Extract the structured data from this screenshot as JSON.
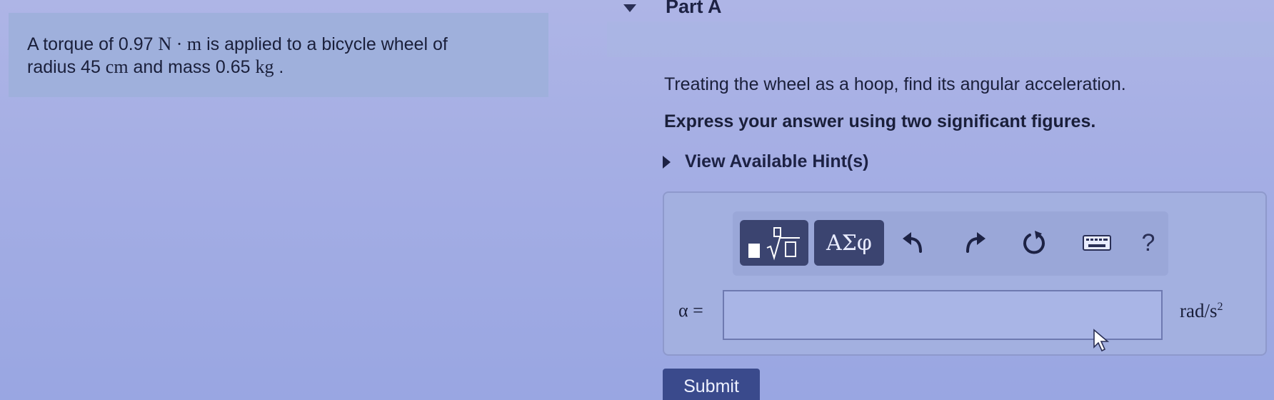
{
  "problem": {
    "line1_prefix": "A torque of 0.97 ",
    "torque_unit": "N · m",
    "line1_suffix": " is applied to a bicycle wheel of",
    "line2_prefix": "radius 45 ",
    "radius_unit": "cm",
    "line2_mid": " and mass 0.65 ",
    "mass_unit": "kg",
    "line2_suffix": " ."
  },
  "part": {
    "title": "Part A",
    "question": "Treating the wheel as a hoop, find its angular acceleration.",
    "instruction": "Express your answer using two significant figures.",
    "hints_label": "View Available Hint(s)"
  },
  "toolbar": {
    "symbols_label": "ΑΣφ",
    "help_label": "?"
  },
  "answer": {
    "variable_label": "α =",
    "value": "",
    "unit_base": "rad/s",
    "unit_exponent": "2"
  },
  "submit": {
    "label": "Submit"
  },
  "colors": {
    "background": "#a5aee4",
    "toolbar_button": "#3b4470",
    "submit_button": "#3a4a8c"
  }
}
